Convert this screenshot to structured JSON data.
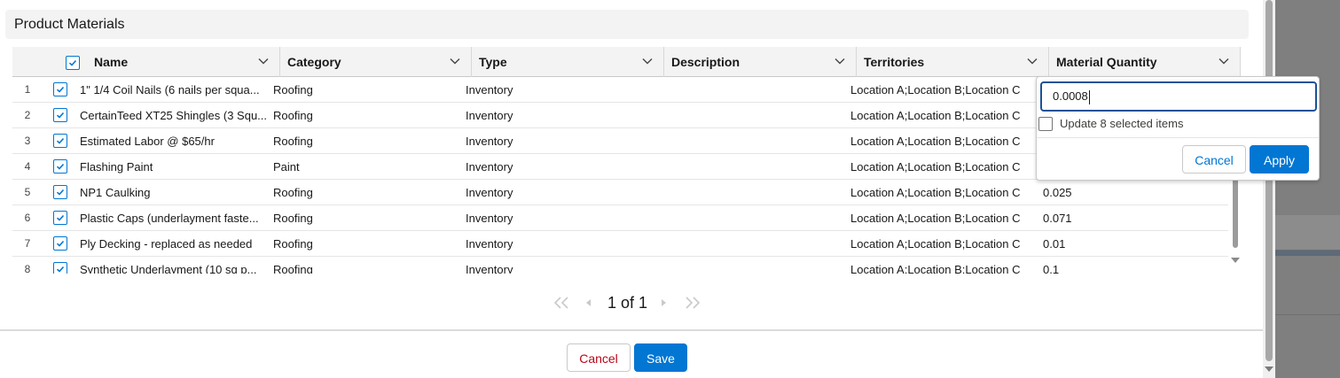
{
  "section": {
    "title": "Product Materials"
  },
  "table": {
    "columns": [
      {
        "key": "name",
        "label": "Name"
      },
      {
        "key": "category",
        "label": "Category"
      },
      {
        "key": "type",
        "label": "Type"
      },
      {
        "key": "description",
        "label": "Description"
      },
      {
        "key": "territories",
        "label": "Territories"
      },
      {
        "key": "quantity",
        "label": "Material Quantity"
      }
    ],
    "rows": [
      {
        "num": "1",
        "name": "1\" 1/4 Coil Nails (6 nails per squa...",
        "category": "Roofing",
        "type": "Inventory",
        "description": "",
        "territories": "Location A;Location B;Location C",
        "quantity": ""
      },
      {
        "num": "2",
        "name": "CertainTeed XT25 Shingles (3 Squ...",
        "category": "Roofing",
        "type": "Inventory",
        "description": "",
        "territories": "Location A;Location B;Location C",
        "quantity": ""
      },
      {
        "num": "3",
        "name": "Estimated Labor @ $65/hr",
        "category": "Roofing",
        "type": "Inventory",
        "description": "",
        "territories": "Location A;Location B;Location C",
        "quantity": ""
      },
      {
        "num": "4",
        "name": "Flashing Paint",
        "category": "Paint",
        "type": "Inventory",
        "description": "",
        "territories": "Location A;Location B;Location C",
        "quantity": ""
      },
      {
        "num": "5",
        "name": "NP1 Caulking",
        "category": "Roofing",
        "type": "Inventory",
        "description": "",
        "territories": "Location A;Location B;Location C",
        "quantity": "0.025"
      },
      {
        "num": "6",
        "name": "Plastic Caps (underlayment faste...",
        "category": "Roofing",
        "type": "Inventory",
        "description": "",
        "territories": "Location A;Location B;Location C",
        "quantity": "0.071"
      },
      {
        "num": "7",
        "name": "Ply Decking - replaced as needed",
        "category": "Roofing",
        "type": "Inventory",
        "description": "",
        "territories": "Location A;Location B;Location C",
        "quantity": "0.01"
      },
      {
        "num": "8",
        "name": "Synthetic Underlayment (10 sq p...",
        "category": "Roofing",
        "type": "Inventory",
        "description": "",
        "territories": "Location A;Location B;Location C",
        "quantity": "0.1"
      }
    ]
  },
  "pagination": {
    "text": "1 of 1"
  },
  "footer": {
    "cancel_label": "Cancel",
    "save_label": "Save"
  },
  "popover": {
    "value": "0.0008",
    "update_label": "Update 8 selected items",
    "cancel_label": "Cancel",
    "apply_label": "Apply"
  },
  "colors": {
    "brand": "#0176d3",
    "header_bg": "#f3f3f3",
    "cancel_text": "#ba0517"
  }
}
